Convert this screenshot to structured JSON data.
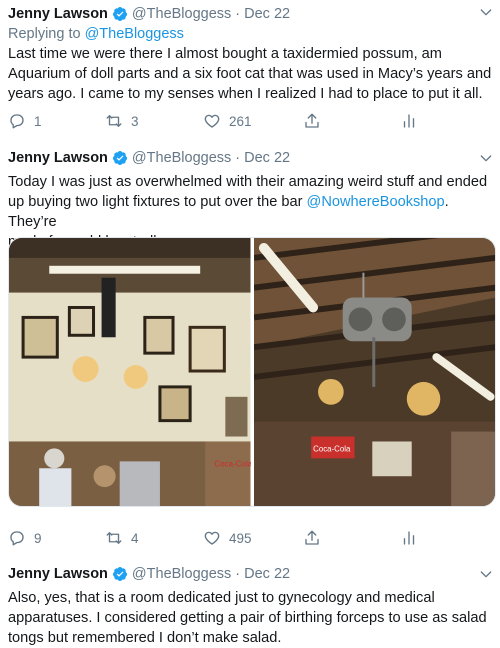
{
  "tweets": [
    {
      "name": "Jenny Lawson",
      "handle": "@TheBloggess",
      "separator": "·",
      "date": "Dec 22",
      "reply_prefix": "Replying to ",
      "reply_mention": "@TheBloggess",
      "text_lines": [
        "Last time we were there I almost bought a taxidermied possum, am",
        "Aquarium of doll parts and a six foot cat that was used in Macy’s years and",
        "years ago. I came to my senses when I realized I had to place to put it all."
      ],
      "reply_count": "1",
      "retweet_count": "3",
      "like_count": "261"
    },
    {
      "name": "Jenny Lawson",
      "handle": "@TheBloggess",
      "separator": "·",
      "date": "Dec 22",
      "text_line1": "Today I was just as overwhelmed with their amazing weird stuff and ended",
      "text_line2_before": "up buying two light fixtures to put over the bar ",
      "text_line2_mention": "@NowhereBookshop",
      "text_line2_after": ". They’re",
      "text_line3": "made from old hay trolleys.",
      "reply_count": "9",
      "retweet_count": "4",
      "like_count": "495",
      "photo_left_sign": "Coca-Cola",
      "photo_right_sign": "Coca-Cola"
    },
    {
      "name": "Jenny Lawson",
      "handle": "@TheBloggess",
      "separator": "·",
      "date": "Dec 22",
      "text_lines": [
        "Also, yes, that is a room dedicated just to gynecology and medical",
        "apparatuses. I considered getting a pair of birthing forceps to use as salad",
        "tongs but remembered I don’t make salad."
      ]
    }
  ],
  "icons": {
    "verified": "verified-badge-icon",
    "chevron": "chevron-down-icon",
    "reply": "reply-icon",
    "retweet": "retweet-icon",
    "like": "heart-icon",
    "share": "share-icon",
    "analytics": "analytics-icon"
  },
  "colors": {
    "text": "#14171a",
    "secondary": "#657786",
    "link": "#1b95e0",
    "verified": "#1da1f2"
  }
}
